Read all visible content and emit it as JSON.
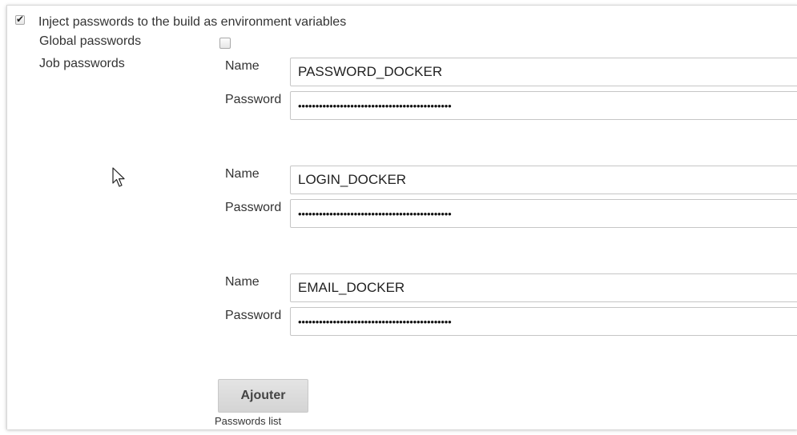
{
  "inject": {
    "label": "Inject passwords to the build as environment variables",
    "checked": true
  },
  "global_passwords": {
    "label": "Global passwords",
    "checked": false
  },
  "job_passwords": {
    "label": "Job passwords",
    "entries": [
      {
        "name_label": "Name",
        "name_value": "PASSWORD_DOCKER",
        "password_label": "Password",
        "password_mask": "••••••••••••••••••••••••••••••••••••••••••••"
      },
      {
        "name_label": "Name",
        "name_value": "LOGIN_DOCKER",
        "password_label": "Password",
        "password_mask": "••••••••••••••••••••••••••••••••••••••••••••"
      },
      {
        "name_label": "Name",
        "name_value": "EMAIL_DOCKER",
        "password_label": "Password",
        "password_mask": "••••••••••••••••••••••••••••••••••••••••••••"
      }
    ]
  },
  "add_button": {
    "label": "Ajouter"
  },
  "passwords_list_hint": "Passwords list",
  "icons": {
    "checkmark": "check-icon",
    "cursor": "mouse-pointer-icon"
  }
}
